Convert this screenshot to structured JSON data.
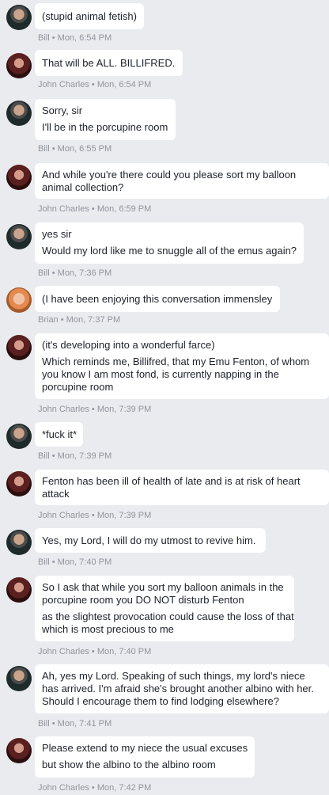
{
  "messages": [
    {
      "author": "Bill",
      "time": "Mon, 6:54 PM",
      "lines": [
        "(stupid animal fetish)"
      ]
    },
    {
      "author": "John Charles",
      "time": "Mon, 6:54 PM",
      "lines": [
        "That will be ALL. BILLIFRED."
      ]
    },
    {
      "author": "Bill",
      "time": "Mon, 6:55 PM",
      "lines": [
        "Sorry, sir",
        "I'll be in the porcupine room"
      ]
    },
    {
      "author": "John Charles",
      "time": "Mon, 6:59 PM",
      "lines": [
        "And while you're there could you please sort my balloon",
        "animal collection?"
      ]
    },
    {
      "author": "Bill",
      "time": "Mon, 7:36 PM",
      "lines": [
        "yes sir",
        "Would my lord like me to snuggle all of the emus again?"
      ]
    },
    {
      "author": "Brian",
      "time": "Mon, 7:37 PM",
      "lines": [
        "(I have been enjoying this conversation immensley"
      ]
    },
    {
      "author": "John Charles",
      "time": "Mon, 7:39 PM",
      "lines": [
        "(it's developing into a wonderful farce)",
        "Which reminds me, Billifred, that my Emu Fenton, of whom",
        "you know I am most fond, is currently napping in the",
        "porcupine room"
      ]
    },
    {
      "author": "Bill",
      "time": "Mon, 7:39 PM",
      "lines": [
        "*fuck it*"
      ]
    },
    {
      "author": "John Charles",
      "time": "Mon, 7:39 PM",
      "lines": [
        "Fenton has been ill of health of late and is at risk of heart",
        "attack"
      ]
    },
    {
      "author": "Bill",
      "time": "Mon, 7:40 PM",
      "lines": [
        "Yes, my Lord, I will do my utmost to revive him."
      ]
    },
    {
      "author": "John Charles",
      "time": "Mon, 7:40 PM",
      "lines": [
        "So I ask that while you sort my balloon animals in the",
        "porcupine room you DO NOT disturb Fenton",
        "as the slightest provocation could cause the loss of that",
        "which is most precious to me"
      ]
    },
    {
      "author": "Bill",
      "time": "Mon, 7:41 PM",
      "lines": [
        "Ah, yes my Lord. Speaking of such things, my lord's niece",
        "has arrived. I'm afraid she's brought another albino with her.",
        "Should I encourage them to find lodging elsewhere?"
      ]
    },
    {
      "author": "John Charles",
      "time": "Mon, 7:42 PM",
      "lines": [
        "Please extend to my niece the usual excuses",
        "but show the albino to the albino room"
      ]
    }
  ]
}
